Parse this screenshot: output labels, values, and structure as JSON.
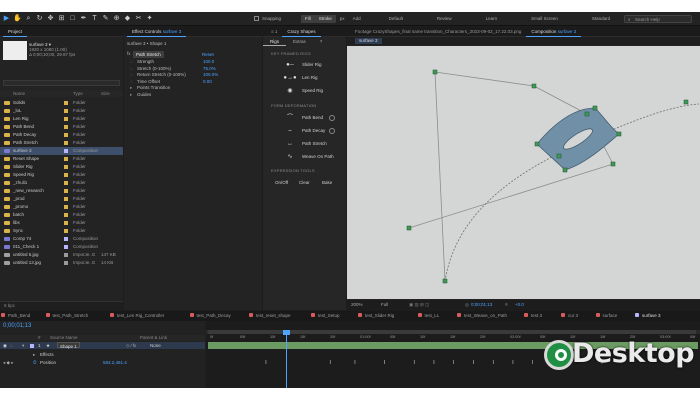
{
  "toolbar": {
    "tools": [
      "select",
      "hand",
      "zoom",
      "orbit",
      "dolly",
      "pan",
      "rect",
      "pen",
      "type",
      "brush",
      "clone",
      "eraser",
      "roto",
      "puppet"
    ],
    "snapping": "Snapping",
    "fill": "Fill",
    "stroke": "Stroke",
    "px": "px",
    "add": "Add",
    "workspaces": [
      "Default",
      "Review",
      "Learn",
      "Small Screen",
      "Standard",
      "Libraries"
    ],
    "active_workspace": "Libraries",
    "help_placeholder": "Search Help"
  },
  "project": {
    "tab": "Project",
    "comp_name": "surfave 3 ▾",
    "comp_info": [
      "1920 x 1080 (1.00)",
      "Δ 0;00;10;00, 29.97 fps"
    ],
    "columns": [
      "Name",
      "Type",
      "Size"
    ],
    "items": [
      {
        "name": "Solids",
        "type": "Folder",
        "size": "",
        "icon": "folder",
        "label": "#d8b24a"
      },
      {
        "name": "_loL",
        "type": "Folder",
        "size": "",
        "icon": "folder",
        "label": "#d8b24a"
      },
      {
        "name": "Len Rig",
        "type": "Folder",
        "size": "",
        "icon": "folder",
        "label": "#d8b24a"
      },
      {
        "name": "Path Bend",
        "type": "Folder",
        "size": "",
        "icon": "folder",
        "label": "#d8b24a"
      },
      {
        "name": "Path Decay",
        "type": "Folder",
        "size": "",
        "icon": "folder",
        "label": "#d8b24a"
      },
      {
        "name": "Path Stretch",
        "type": "Folder",
        "size": "",
        "icon": "folder",
        "label": "#d8b24a"
      },
      {
        "name": "surfave 3",
        "type": "Composition",
        "size": "",
        "icon": "comp",
        "label": "#b7b7ff",
        "selected": true
      },
      {
        "name": "Reset Shape",
        "type": "Folder",
        "size": "",
        "icon": "folder",
        "label": "#d8b24a"
      },
      {
        "name": "Slider Rig",
        "type": "Folder",
        "size": "",
        "icon": "folder",
        "label": "#d8b24a"
      },
      {
        "name": "Speed Rig",
        "type": "Folder",
        "size": "",
        "icon": "folder",
        "label": "#d8b24a"
      },
      {
        "name": "_zhuli1",
        "type": "Folder",
        "size": "",
        "icon": "folder",
        "label": "#d8b24a"
      },
      {
        "name": "_new_research",
        "type": "Folder",
        "size": "",
        "icon": "folder",
        "label": "#d8b24a"
      },
      {
        "name": "_prod",
        "type": "Folder",
        "size": "",
        "icon": "folder",
        "label": "#d8b24a"
      },
      {
        "name": "_promo",
        "type": "Folder",
        "size": "",
        "icon": "folder",
        "label": "#d8b24a"
      },
      {
        "name": "batch",
        "type": "Folder",
        "size": "",
        "icon": "folder",
        "label": "#d8b24a"
      },
      {
        "name": "libs",
        "type": "Folder",
        "size": "",
        "icon": "folder",
        "label": "#d8b24a"
      },
      {
        "name": "Sync",
        "type": "Folder",
        "size": "",
        "icon": "folder",
        "label": "#d8b24a"
      },
      {
        "name": "Comp 74",
        "type": "Composition",
        "size": "",
        "icon": "comp",
        "label": "#b7b7ff"
      },
      {
        "name": "011_Check 1",
        "type": "Composition",
        "size": "",
        "icon": "comp",
        "label": "#b7b7ff"
      },
      {
        "name": "untitled 6.jpg",
        "type": "ImporJe..G",
        "size": "147 KB",
        "icon": "file",
        "label": "#9a9a9a"
      },
      {
        "name": "untitled 13.jpg",
        "type": "ImporJe..G",
        "size": "14 KB",
        "icon": "file",
        "label": "#9a9a9a"
      }
    ],
    "footer": "8 bpc"
  },
  "effects": {
    "tab": "Effect Controls",
    "tab_target": "surfave 3",
    "breadcrumb": "surfave 3 • Shape 1",
    "effect_name": "Path Stretch",
    "reset": "Reset",
    "props": [
      {
        "label": "Strength",
        "value": "100.0"
      },
      {
        "label": "Stretch (0-100%)",
        "value": "75.0%"
      },
      {
        "label": "Return Stretch (0-100%)",
        "value": "100.0%"
      },
      {
        "label": "Time Offset",
        "value": "0.00"
      },
      {
        "label": "Points Transition",
        "value": ""
      },
      {
        "label": "Guides",
        "value": ""
      }
    ]
  },
  "shapes": {
    "tab_index": "≡ 1",
    "tab": "Crazy Shapes",
    "subtabs": [
      "Rigs",
      "Extras"
    ],
    "help": "?",
    "sections": {
      "keys": "KEY FRAMED RIGS",
      "deform": "FORM DEFORMATION",
      "expr": "EXPRESSION TOOLS"
    },
    "buttons": [
      {
        "label": "Slider Rig",
        "icon": "●─"
      },
      {
        "label": "Len Rig",
        "icon": "●→●"
      },
      {
        "label": "Speed Rig",
        "icon": "◉"
      },
      {
        "label": "Path Bend",
        "icon": "⌒"
      },
      {
        "label": "Path Decay",
        "icon": "⌢"
      },
      {
        "label": "Path Stretch",
        "icon": "↔"
      },
      {
        "label": "Weave On Path",
        "icon": "∿"
      }
    ],
    "expr_buttons": [
      "On/Off",
      "Clear",
      "Bake"
    ]
  },
  "comp": {
    "footage_tab": "Footage CrazyShapes_final name transition_Characters_2023-09-02_17.22.03.png",
    "comp_tab": "Composition",
    "comp_tab_target": "surfave 3",
    "breadcrumb": "surfave 3",
    "zoom": "200%",
    "resolution": "Full",
    "timecode": "0;00;01;13",
    "offset": "+0.0"
  },
  "timeline": {
    "tabs": [
      {
        "label": "Path_Bend",
        "color": "#d95b5b"
      },
      {
        "label": "test_Path_Stretch",
        "color": "#d95b5b"
      },
      {
        "label": "test_Len Rig_Controller",
        "color": "#d95b5b"
      },
      {
        "label": "test_Path_Decay",
        "color": "#d95b5b"
      },
      {
        "label": "test_reset_shape",
        "color": "#d95b5b"
      },
      {
        "label": "test_Setup",
        "color": "#d95b5b"
      },
      {
        "label": "test_Slider Rig",
        "color": "#d95b5b"
      },
      {
        "label": "test_LL",
        "color": "#d95b5b"
      },
      {
        "label": "test_Weave_on_Path",
        "color": "#d95b5b"
      },
      {
        "label": "test 3",
        "color": "#d95b5b"
      },
      {
        "label": "cur 3",
        "color": "#d95b5b"
      },
      {
        "label": "surface",
        "color": "#d95b5b"
      },
      {
        "label": "surfave 3",
        "color": "#b7b7ff",
        "active": true
      }
    ],
    "timecode": "0;00;01;13",
    "columns": [
      "#",
      "Source Name",
      "Parent & Link"
    ],
    "layer": {
      "index": "1",
      "name": "Shape 1",
      "parent": "None"
    },
    "sublines": [
      {
        "label": "Effects",
        "value": ""
      },
      {
        "label": "Position",
        "value": "583.2,461.4"
      }
    ],
    "ruler": [
      "0f",
      "05f",
      "10f",
      "15f",
      "20f",
      "01:00f",
      "05f",
      "10f",
      "15f",
      "20f",
      "02:00f",
      "05f",
      "10f",
      "15f",
      "20f",
      "03:00f",
      "05f"
    ],
    "keyframe_fractions": [
      0.12,
      0.25,
      0.3,
      0.36,
      0.42,
      0.46,
      0.5,
      0.54,
      0.58,
      0.62,
      0.66,
      0.7,
      0.8
    ]
  },
  "watermark": {
    "text": "Desktop"
  }
}
